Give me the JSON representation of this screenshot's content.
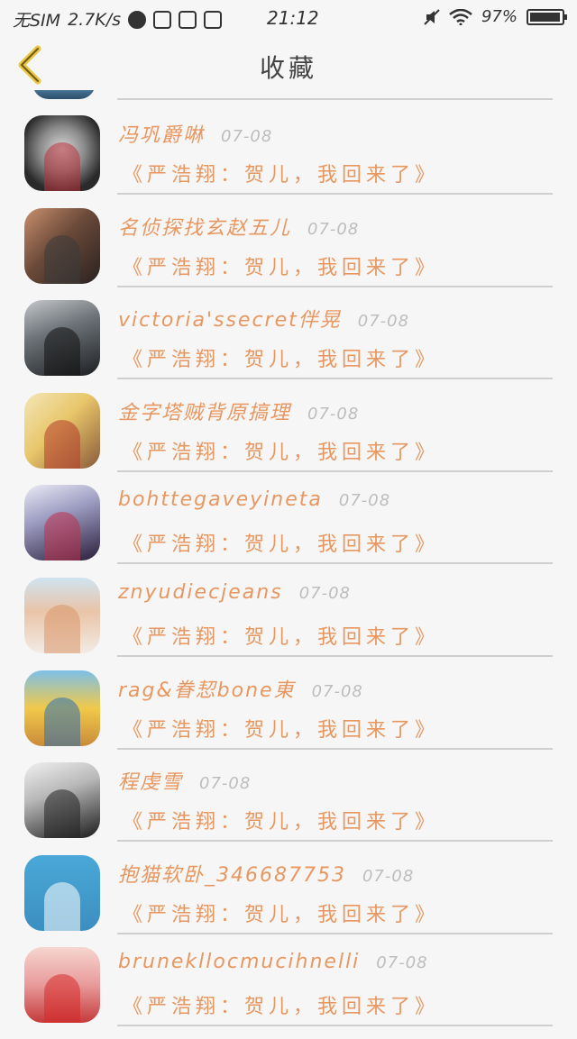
{
  "status_bar": {
    "carrier": "无SIM",
    "speed": "2.7K/s",
    "time": "21:12",
    "battery": "97%",
    "battery_level": 0.97,
    "icons": [
      "weibo-icon",
      "app-icon",
      "s-icon",
      "database-icon",
      "mute-icon",
      "wifi-icon",
      "battery-icon"
    ]
  },
  "header": {
    "title": "收藏",
    "back_icon": "chevron-left-icon",
    "accent": "#e8c64a"
  },
  "colors": {
    "name": "#e89760",
    "date": "#bdbdbd",
    "divider": "#cfcfcf",
    "background": "#f6f6f6"
  },
  "favorites": [
    {
      "name": "冯巩爵啉",
      "date": "07-08",
      "message": "《严浩翔：贺儿，我回来了》",
      "avatar_bg": "radial-gradient(circle at 50% 45%, #d9d9d9 0%, #8a8a8a 40%, #2a2a2a 75%)",
      "avatar_accent": "#b8323a"
    },
    {
      "name": "名侦探找玄赵五儿",
      "date": "07-08",
      "message": "《严浩翔：贺儿，我回来了》",
      "avatar_bg": "linear-gradient(135deg, #c98f6c 0%, #6b4a3a 45%, #2a2220 100%)",
      "avatar_accent": "#3a3a3a"
    },
    {
      "name": "victoria'ssecret伴晃",
      "date": "07-08",
      "message": "《严浩翔：贺儿，我回来了》",
      "avatar_bg": "linear-gradient(160deg, #c5c8cc 0%, #6d7378 40%, #1d1f22 100%)",
      "avatar_accent": "#111111"
    },
    {
      "name": "金字塔贼背原搞理",
      "date": "07-08",
      "message": "《严浩翔：贺儿，我回来了》",
      "avatar_bg": "linear-gradient(135deg, #f4e6b8 0%, #e8c66a 45%, #8a5a3a 100%)",
      "avatar_accent": "#b23a2a"
    },
    {
      "name": "bohttegaveyineta",
      "date": "07-08",
      "message": "《严浩翔：贺儿，我回来了》",
      "avatar_bg": "linear-gradient(160deg, #eaeaf5 0%, #9d9cc2 40%, #2a1f3a 100%)",
      "avatar_accent": "#c0304a"
    },
    {
      "name": "znyudiecjeans",
      "date": "07-08",
      "message": "《严浩翔：贺儿，我回来了》",
      "avatar_bg": "linear-gradient(180deg, #cfe3f0 0%, #e9c4a8 45%, #f3ebe5 100%)",
      "avatar_accent": "#d9956a"
    },
    {
      "name": "rag&眷恝bone東",
      "date": "07-08",
      "message": "《严浩翔：贺儿，我回来了》",
      "avatar_bg": "linear-gradient(180deg, #7cc0e8 0%, #f2c94a 50%, #c98b3a 100%)",
      "avatar_accent": "#2a6fb0"
    },
    {
      "name": "程虔雪",
      "date": "07-08",
      "message": "《严浩翔：贺儿，我回来了》",
      "avatar_bg": "linear-gradient(160deg, #f0f0f0 0%, #b8b8b8 40%, #1c1c1c 100%)",
      "avatar_accent": "#222222"
    },
    {
      "name": "抱猫软卧_346687753",
      "date": "07-08",
      "message": "《严浩翔：贺儿，我回来了》",
      "avatar_bg": "linear-gradient(180deg, #4aa8d8 0%, #3b8fc0 100%)",
      "avatar_accent": "#ffffff"
    },
    {
      "name": "bruneklloсmucihnelli",
      "date": "07-08",
      "message": "《严浩翔：贺儿，我回来了》",
      "avatar_bg": "linear-gradient(180deg, #f6d6d0 0%, #e89a9a 50%, #c63a3a 100%)",
      "avatar_accent": "#d62a2a"
    }
  ]
}
